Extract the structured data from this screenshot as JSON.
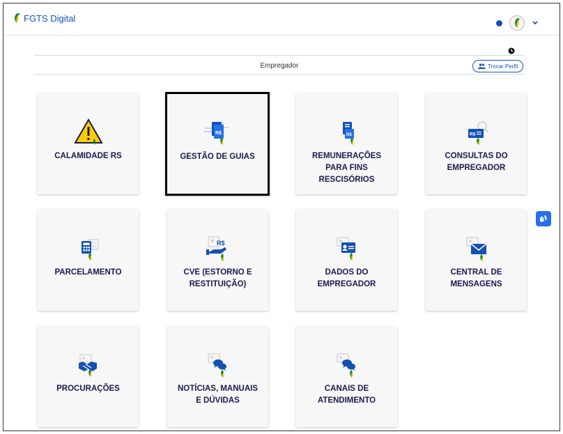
{
  "header": {
    "brand": "FGTS Digital"
  },
  "profile": {
    "label": "Empregador",
    "switch_button": "Trocar Perfil"
  },
  "colors": {
    "primary": "#1351b4",
    "card_bg": "#f7f7f7",
    "label": "#1a1a4e",
    "leaf_green": "#168821",
    "leaf_yellow": "#ffcd07"
  },
  "cards": [
    {
      "label": "CALAMIDADE RS",
      "icon": "warning-icon"
    },
    {
      "label": "GESTÃO DE GUIAS",
      "icon": "guides-icon"
    },
    {
      "label": "REMUNERAÇÕES\nPARA FINS\nRESCISÓRIOS",
      "icon": "document-money-icon"
    },
    {
      "label": "CONSULTAS DO\nEMPREGADOR",
      "icon": "search-money-icon"
    },
    {
      "label": "PARCELAMENTO",
      "icon": "calculator-icon"
    },
    {
      "label": "CVE (ESTORNO E\nRESTITUIÇÃO)",
      "icon": "refund-icon"
    },
    {
      "label": "DADOS DO\nEMPREGADOR",
      "icon": "id-card-icon"
    },
    {
      "label": "CENTRAL DE\nMENSAGENS",
      "icon": "envelope-icon"
    },
    {
      "label": "PROCURAÇÕES",
      "icon": "handshake-icon"
    },
    {
      "label": "NOTÍCIAS, MANUAIS\nE DÚVIDAS",
      "icon": "chat-icon"
    },
    {
      "label": "CANAIS DE\nATENDIMENTO",
      "icon": "chat-support-icon"
    }
  ]
}
